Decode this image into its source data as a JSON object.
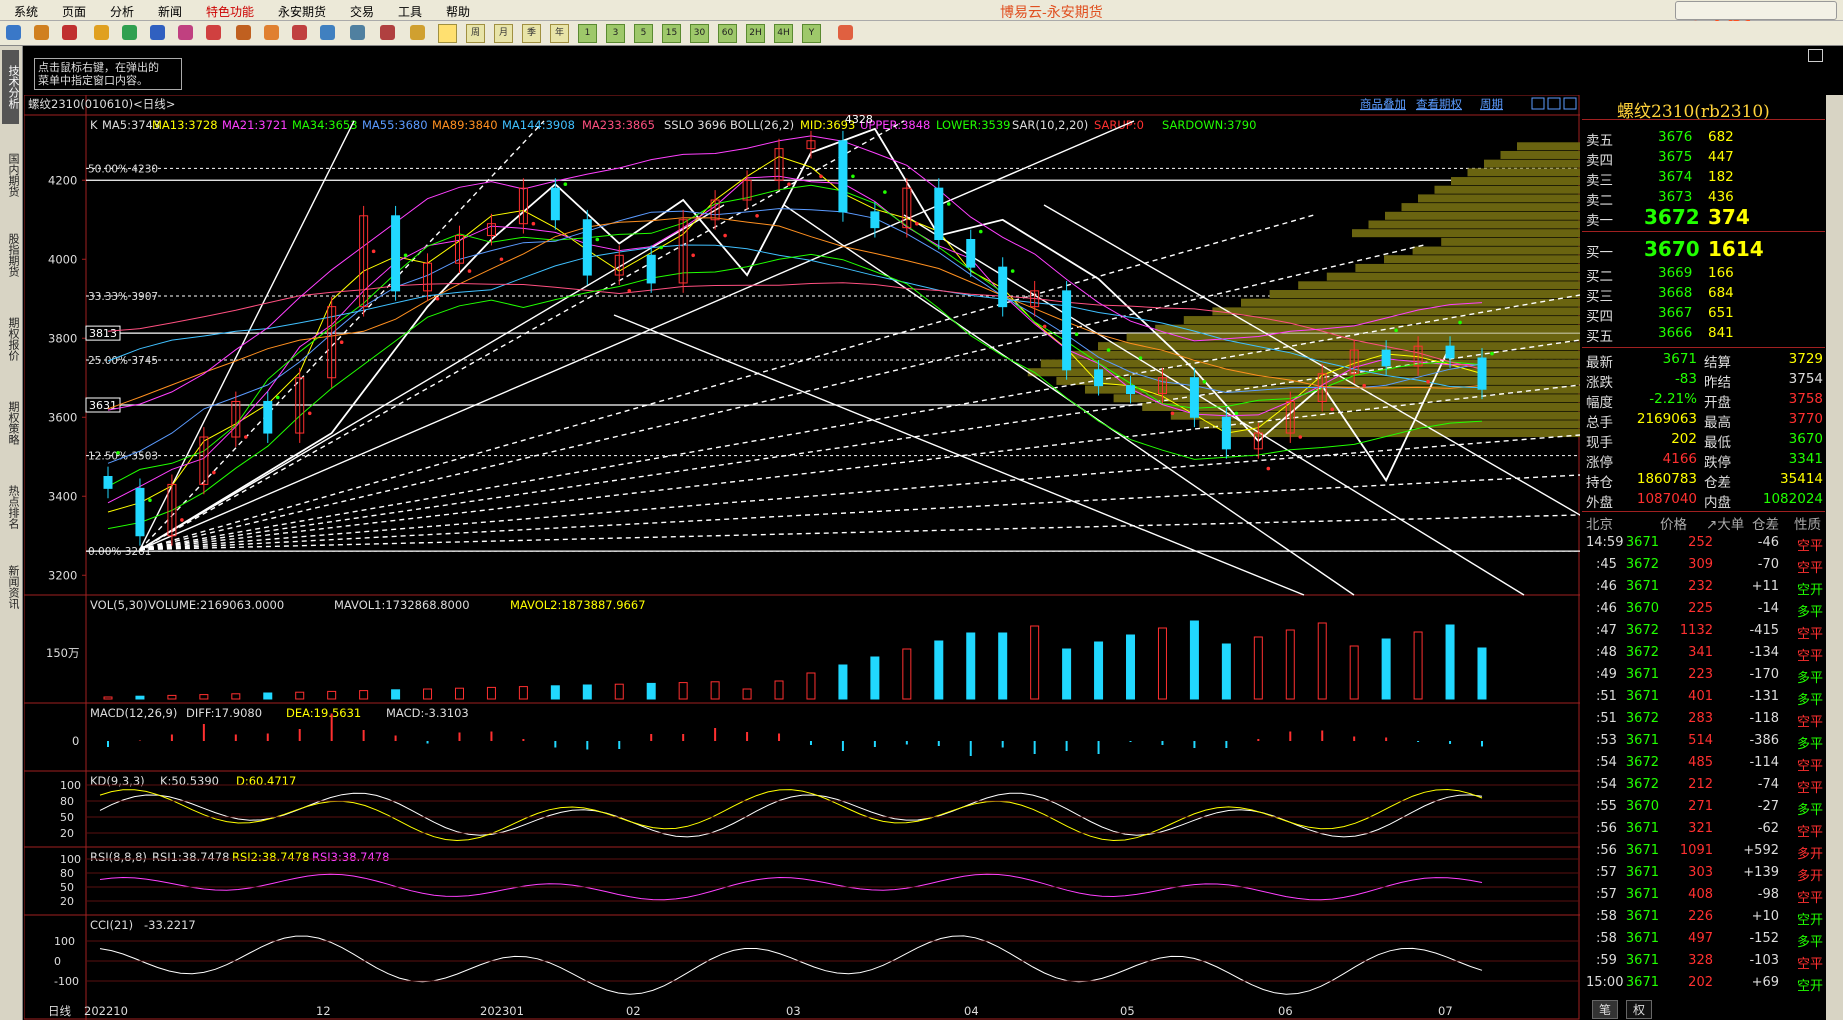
{
  "menu": {
    "items": [
      "系统",
      "页面",
      "分析",
      "新闻",
      "特色功能",
      "永安期货",
      "交易",
      "工具",
      "帮助"
    ],
    "highlight_index": 4,
    "app_title": "博易云-永安期货",
    "watermark": "5E大资5etz.com"
  },
  "toolbar": {
    "period_buttons": [
      "周",
      "月",
      "季",
      "年",
      "1",
      "3",
      "5",
      "15",
      "30",
      "60",
      "2H",
      "4H",
      "Y"
    ]
  },
  "sidebar": {
    "tabs": [
      "技术分析",
      "国内期货",
      "股指期货",
      "期权报价",
      "期权策略",
      "热点排名",
      "新闻资讯"
    ],
    "active_index": 0
  },
  "note": {
    "line1": "点击鼠标右键，在弹出的",
    "line2": "菜单中指定窗口内容。"
  },
  "chart_header": {
    "symbol": "螺纹2310(010610)<日线>",
    "links": [
      "商品叠加",
      "查看期权",
      "周期"
    ]
  },
  "indicators": {
    "main": [
      {
        "text": "K",
        "color": "#dddddd"
      },
      {
        "text": "MA5:3743",
        "color": "#dddddd"
      },
      {
        "text": "MA13:3728",
        "color": "#ffff00"
      },
      {
        "text": "MA21:3721",
        "color": "#ff40ff"
      },
      {
        "text": "MA34:3653",
        "color": "#21ff00"
      },
      {
        "text": "MA55:3680",
        "color": "#5b9bff"
      },
      {
        "text": "MA89:3840",
        "color": "#ff9020"
      },
      {
        "text": "MA144:3908",
        "color": "#40c0ff"
      },
      {
        "text": "MA233:3865",
        "color": "#ff5080"
      },
      {
        "text": "SSLO 3696",
        "color": "#dddddd"
      },
      {
        "text": "BOLL(26,2)",
        "color": "#dddddd"
      },
      {
        "text": "MID:3693",
        "color": "#ffff00"
      },
      {
        "text": "UPPER:3848",
        "color": "#ff40ff"
      },
      {
        "text": "LOWER:3539",
        "color": "#21ff00"
      },
      {
        "text": "SAR(10,2,20)",
        "color": "#dddddd"
      },
      {
        "text": "SARUP:0",
        "color": "#ff3030"
      },
      {
        "text": "SARDOWN:3790",
        "color": "#21ff00"
      }
    ],
    "vol": {
      "label": "VOL(5,30)",
      "volume": "VOLUME:2169063.0000",
      "mavol1": "MAVOL1:1732868.8000",
      "mavol2": "MAVOL2:1873887.9667",
      "axis": "150万"
    },
    "macd": {
      "label": "MACD(12,26,9)",
      "diff": "DIFF:17.9080",
      "dea": "DEA:19.5631",
      "macd": "MACD:-3.3103",
      "axis": "0"
    },
    "kd": {
      "label": "KD(9,3,3)",
      "k": "K:50.5390",
      "d": "D:60.4717",
      "axis": [
        "100",
        "80",
        "50",
        "20"
      ]
    },
    "rsi": {
      "label": "RSI(8,8,8)",
      "rsi1": "RSI1:38.7478",
      "rsi2": "RSI2:38.7478",
      "rsi3": "RSI3:38.7478",
      "axis": [
        "100",
        "80",
        "50",
        "20"
      ]
    },
    "cci": {
      "label": "CCI(21)",
      "value": "-33.2217",
      "axis": [
        "100",
        "0",
        "-100"
      ]
    }
  },
  "price_axis": [
    "4200",
    "4000",
    "3800",
    "3600",
    "3400",
    "3200"
  ],
  "fib_labels": [
    "50.00% 4230",
    "33.33% 3907",
    "25.00% 3745",
    "12.50% 3503",
    "0.00% 3261"
  ],
  "price_boxes": [
    "3813",
    "3631"
  ],
  "peak_label": "4328",
  "date_axis": [
    "日线",
    "202210",
    "12",
    "202301",
    "02",
    "03",
    "04",
    "05",
    "06",
    "07"
  ],
  "chart_data": {
    "type": "candlestick",
    "symbol": "螺纹2310",
    "ylim": [
      3150,
      4350
    ],
    "x": [
      "2022-10-31",
      "2022-11-04",
      "2022-11-10",
      "2022-11-16",
      "2022-11-22",
      "2022-11-28",
      "2022-12-02",
      "2022-12-08",
      "2022-12-14",
      "2022-12-20",
      "2022-12-26",
      "2023-01-04",
      "2023-01-10",
      "2023-01-16",
      "2023-01-30",
      "2023-02-03",
      "2023-02-09",
      "2023-02-15",
      "2023-02-21",
      "2023-02-27",
      "2023-03-03",
      "2023-03-09",
      "2023-03-15",
      "2023-03-21",
      "2023-03-27",
      "2023-03-31",
      "2023-04-06",
      "2023-04-12",
      "2023-04-18",
      "2023-04-24",
      "2023-05-04",
      "2023-05-10",
      "2023-05-16",
      "2023-05-22",
      "2023-05-26",
      "2023-06-01",
      "2023-06-07",
      "2023-06-13",
      "2023-06-19",
      "2023-06-27",
      "2023-07-03",
      "2023-07-07",
      "2023-07-13",
      "2023-07-14"
    ],
    "close": [
      3420,
      3300,
      3430,
      3550,
      3640,
      3560,
      3700,
      3880,
      4110,
      3920,
      3990,
      4060,
      4090,
      4180,
      4100,
      3960,
      4010,
      3940,
      4100,
      4150,
      4200,
      4280,
      4300,
      4120,
      4080,
      4180,
      4050,
      3980,
      3880,
      3920,
      3720,
      3680,
      3660,
      3700,
      3600,
      3520,
      3560,
      3640,
      3710,
      3770,
      3730,
      3780,
      3750,
      3671
    ]
  },
  "quote": {
    "title": "螺纹2310(rb2310)",
    "asks": [
      {
        "label": "卖五",
        "price": "3676",
        "vol": "682"
      },
      {
        "label": "卖四",
        "price": "3675",
        "vol": "447"
      },
      {
        "label": "卖三",
        "price": "3674",
        "vol": "182"
      },
      {
        "label": "卖二",
        "price": "3673",
        "vol": "436"
      },
      {
        "label": "卖一",
        "price": "3672",
        "vol": "374"
      }
    ],
    "bids": [
      {
        "label": "买一",
        "price": "3670",
        "vol": "1614"
      },
      {
        "label": "买二",
        "price": "3669",
        "vol": "166"
      },
      {
        "label": "买三",
        "price": "3668",
        "vol": "684"
      },
      {
        "label": "买四",
        "price": "3667",
        "vol": "651"
      },
      {
        "label": "买五",
        "price": "3666",
        "vol": "841"
      }
    ],
    "stats": [
      {
        "l1": "最新",
        "v1": "3671",
        "c1": "g",
        "l2": "结算",
        "v2": "3729",
        "c2": "y"
      },
      {
        "l1": "涨跌",
        "v1": "-83",
        "c1": "g",
        "l2": "昨结",
        "v2": "3754",
        "c2": "w"
      },
      {
        "l1": "幅度",
        "v1": "-2.21%",
        "c1": "g",
        "l2": "开盘",
        "v2": "3758",
        "c2": "r"
      },
      {
        "l1": "总手",
        "v1": "2169063",
        "c1": "y",
        "l2": "最高",
        "v2": "3770",
        "c2": "r"
      },
      {
        "l1": "现手",
        "v1": "202",
        "c1": "y",
        "l2": "最低",
        "v2": "3670",
        "c2": "g"
      },
      {
        "l1": "涨停",
        "v1": "4166",
        "c1": "r",
        "l2": "跌停",
        "v2": "3341",
        "c2": "g"
      },
      {
        "l1": "持仓",
        "v1": "1860783",
        "c1": "y",
        "l2": "仓差",
        "v2": "35414",
        "c2": "y"
      },
      {
        "l1": "外盘",
        "v1": "1087040",
        "c1": "r",
        "l2": "内盘",
        "v2": "1082024",
        "c2": "g"
      }
    ],
    "tick_header": [
      "北京",
      "价格",
      "↗大单",
      "仓差",
      "性质"
    ],
    "ticks": [
      {
        "t": "14:59",
        "p": "3671",
        "v": "252",
        "d": "-46",
        "n": "空平",
        "nc": "r"
      },
      {
        "t": ":45",
        "p": "3672",
        "v": "309",
        "d": "-70",
        "n": "空平",
        "nc": "r"
      },
      {
        "t": ":46",
        "p": "3671",
        "v": "232",
        "d": "+11",
        "n": "空开",
        "nc": "g"
      },
      {
        "t": ":46",
        "p": "3670",
        "v": "225",
        "d": "-14",
        "n": "多平",
        "nc": "g"
      },
      {
        "t": ":47",
        "p": "3672",
        "v": "1132",
        "d": "-415",
        "n": "空平",
        "nc": "r"
      },
      {
        "t": ":48",
        "p": "3672",
        "v": "341",
        "d": "-134",
        "n": "空平",
        "nc": "r"
      },
      {
        "t": ":49",
        "p": "3671",
        "v": "223",
        "d": "-170",
        "n": "多平",
        "nc": "g"
      },
      {
        "t": ":51",
        "p": "3671",
        "v": "401",
        "d": "-131",
        "n": "多平",
        "nc": "g"
      },
      {
        "t": ":51",
        "p": "3672",
        "v": "283",
        "d": "-118",
        "n": "空平",
        "nc": "r"
      },
      {
        "t": ":53",
        "p": "3671",
        "v": "514",
        "d": "-386",
        "n": "多平",
        "nc": "g"
      },
      {
        "t": ":54",
        "p": "3672",
        "v": "485",
        "d": "-114",
        "n": "空平",
        "nc": "r"
      },
      {
        "t": ":54",
        "p": "3672",
        "v": "212",
        "d": "-74",
        "n": "空平",
        "nc": "r"
      },
      {
        "t": ":55",
        "p": "3670",
        "v": "271",
        "d": "-27",
        "n": "多平",
        "nc": "g"
      },
      {
        "t": ":56",
        "p": "3671",
        "v": "321",
        "d": "-62",
        "n": "空平",
        "nc": "r"
      },
      {
        "t": ":56",
        "p": "3671",
        "v": "1091",
        "d": "+592",
        "n": "多开",
        "nc": "r"
      },
      {
        "t": ":57",
        "p": "3671",
        "v": "303",
        "d": "+139",
        "n": "多开",
        "nc": "r"
      },
      {
        "t": ":57",
        "p": "3671",
        "v": "408",
        "d": "-98",
        "n": "空平",
        "nc": "r"
      },
      {
        "t": ":58",
        "p": "3671",
        "v": "226",
        "d": "+10",
        "n": "空开",
        "nc": "g"
      },
      {
        "t": ":58",
        "p": "3671",
        "v": "497",
        "d": "-152",
        "n": "多平",
        "nc": "g"
      },
      {
        "t": ":59",
        "p": "3671",
        "v": "328",
        "d": "-103",
        "n": "空平",
        "nc": "r"
      },
      {
        "t": "15:00",
        "p": "3671",
        "v": "202",
        "d": "+69",
        "n": "空开",
        "nc": "g"
      }
    ],
    "bottom_tabs": [
      "笔",
      "权"
    ]
  },
  "colors": {
    "up": "#ff3030",
    "down": "#21d8ff",
    "grid": "#a02020",
    "accent": "#ffd23a"
  }
}
